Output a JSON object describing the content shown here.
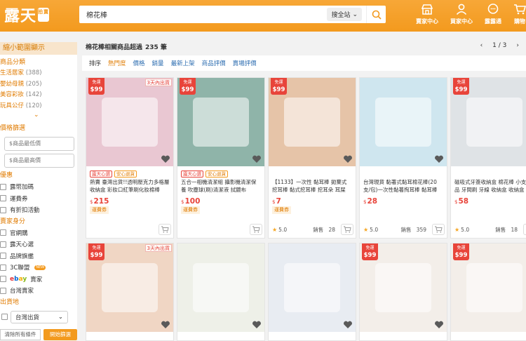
{
  "header": {
    "logo": "露天",
    "logo_badge": "拍賣",
    "search_value": "棉花棒",
    "search_scope": "搜全站",
    "nav": [
      {
        "label": "賣家中心",
        "icon": "store-icon"
      },
      {
        "label": "買家中心",
        "icon": "user-icon"
      },
      {
        "label": "露露通",
        "icon": "chat-icon"
      },
      {
        "label": "購物",
        "icon": "cart-icon"
      }
    ]
  },
  "sidebar": {
    "narrow_title": "縮小範圍顯示",
    "category_title": "商品分類",
    "categories": [
      {
        "name": "生活居家",
        "count": "(388)"
      },
      {
        "name": "嬰幼母親",
        "count": "(205)"
      },
      {
        "name": "美容彩妝",
        "count": "(142)"
      },
      {
        "name": "玩具公仔",
        "count": "(120)"
      }
    ],
    "price_title": "價格篩選",
    "price_min_placeholder": "$商品最低價",
    "price_max_placeholder": "$商品最高價",
    "offers_title": "優惠",
    "offers": [
      "露幣加碼",
      "運費券",
      "有折扣活動"
    ],
    "seller_title": "賣家身分",
    "seller_types": [
      "官網購",
      "露天心選",
      "品牌旗艦",
      "3C聯盟",
      "ebay賣家",
      "台灣賣家"
    ],
    "new_badge": "NEW",
    "origin_title": "出貨地",
    "origin_value": "台灣出貨",
    "clear_label": "清除所有條件",
    "apply_label": "開始篩選"
  },
  "results": {
    "summary": "棉花棒相關商品超過",
    "count": "235 筆",
    "page": "1 / 3",
    "sort_label": "排序",
    "sort_options": [
      "熱門度",
      "價格",
      "銷量",
      "最新上架",
      "商品評價",
      "賣場評價"
    ]
  },
  "products": [
    {
      "tag99_top": "免運",
      "tag99_price": "$99",
      "ship": "3天內出貨",
      "badge1": "露天心選",
      "badge2": "安心退貨",
      "title": "熱賣 臺灣出貨!!透明壓克力多格層收納盒 彩妝口紅筆刷化妝棉棒",
      "currency": "$",
      "price": "215",
      "coupon": "運費券",
      "rating": "",
      "sold": "",
      "color": "#e9c7d2"
    },
    {
      "tag99_top": "免運",
      "tag99_price": "$99",
      "ship": "",
      "badge1": "露天心選",
      "badge2": "安心退貨",
      "title": "五合一相機清潔組 攝影機清潔保養 吹塵球(刷)清潔液 拭鏡布",
      "currency": "$",
      "price": "100",
      "coupon": "運費券",
      "rating": "",
      "sold": "",
      "color": "#8fb4a9"
    },
    {
      "tag99_top": "免運",
      "tag99_price": "$99",
      "ship": "",
      "badge1": "",
      "badge2": "",
      "title": "【1133】一次性 黏耳棒 拋棄式 挖耳棒 黏式挖耳棒 挖耳朵 耳屎",
      "currency": "$",
      "price": "7",
      "coupon": "運費券",
      "rating": "5.0",
      "sold": "28",
      "color": "#e6c4a8"
    },
    {
      "tag99_top": "",
      "tag99_price": "",
      "ship": "",
      "badge1": "",
      "badge2": "",
      "title": "台灣現貨 黏著式黏耳棉花棒(20支/包)一次性黏著掏耳棒 黏耳棒",
      "currency": "$",
      "price": "28",
      "coupon": "",
      "rating": "5.0",
      "sold": "359",
      "color": "#cfe6ef"
    },
    {
      "tag99_top": "免運",
      "tag99_price": "$99",
      "ship": "",
      "badge1": "",
      "badge2": "",
      "title": "磁吸式牙簽收納盒 棉花棒 小支飾品 牙間刷 牙線 收納盒 收納盒",
      "currency": "$",
      "price": "58",
      "coupon": "",
      "rating": "5.0",
      "sold": "18",
      "color": "#dfe3e6"
    },
    {
      "tag99_top": "免運",
      "tag99_price": "$99",
      "ship": "3天內出貨",
      "badge1": "",
      "badge2": "",
      "title": "",
      "currency": "",
      "price": "",
      "coupon": "",
      "rating": "",
      "sold": "",
      "color": "#f0d6c4"
    },
    {
      "tag99_top": "",
      "tag99_price": "",
      "ship": "",
      "badge1": "",
      "badge2": "",
      "title": "",
      "currency": "",
      "price": "",
      "coupon": "",
      "rating": "",
      "sold": "",
      "color": "#eef0e8"
    },
    {
      "tag99_top": "",
      "tag99_price": "",
      "ship": "",
      "badge1": "",
      "badge2": "",
      "title": "",
      "currency": "",
      "price": "",
      "coupon": "",
      "rating": "",
      "sold": "",
      "color": "#e8ecf2"
    },
    {
      "tag99_top": "免運",
      "tag99_price": "$99",
      "ship": "",
      "badge1": "",
      "badge2": "",
      "title": "",
      "currency": "",
      "price": "",
      "coupon": "",
      "rating": "",
      "sold": "",
      "color": "#f3eee9"
    },
    {
      "tag99_top": "免運",
      "tag99_price": "$99",
      "ship": "",
      "badge1": "",
      "badge2": "",
      "title": "",
      "currency": "",
      "price": "",
      "coupon": "",
      "rating": "",
      "sold": "",
      "color": "#f3eee9"
    }
  ],
  "labels": {
    "sold_prefix": "銷售"
  }
}
